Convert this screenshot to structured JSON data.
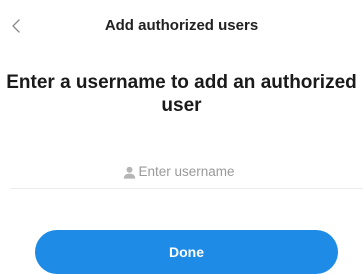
{
  "header": {
    "title": "Add authorized users",
    "back_icon": "chevron-left-icon"
  },
  "main": {
    "headline": "Enter a username to add an authorized user",
    "username_field": {
      "icon": "user-icon",
      "placeholder": "Enter username",
      "value": ""
    },
    "done_label": "Done"
  },
  "colors": {
    "accent": "#1e8ce6",
    "placeholder": "#9a9a9a",
    "divider": "#ececec"
  }
}
